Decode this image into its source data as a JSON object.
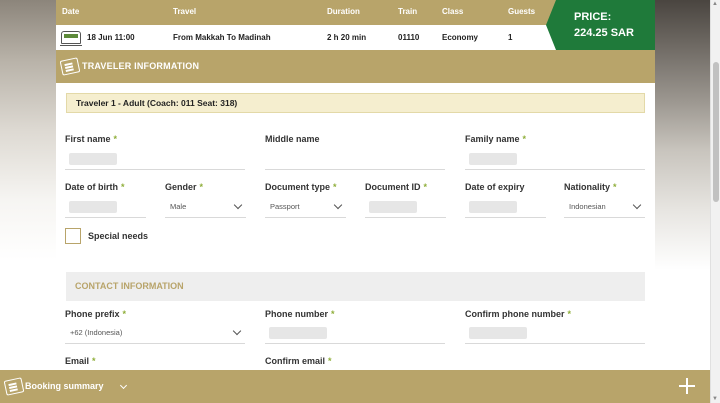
{
  "trip": {
    "headers": {
      "date": "Date",
      "travel": "Travel",
      "duration": "Duration",
      "train": "Train",
      "class": "Class",
      "guests": "Guests"
    },
    "date": "18 Jun 11:00",
    "travel": "From Makkah To Madinah",
    "duration": "2 h 20 min",
    "train": "01110",
    "class": "Economy",
    "guests": "1"
  },
  "price": {
    "label": "PRICE:",
    "value": "224.25 SAR"
  },
  "traveler_section": {
    "title": "TRAVELER INFORMATION"
  },
  "traveler": {
    "banner": "Traveler 1 - Adult (Coach: 011 Seat: 318)"
  },
  "fields": {
    "first_name": {
      "label": "First name"
    },
    "middle_name": {
      "label": "Middle name"
    },
    "family_name": {
      "label": "Family name"
    },
    "date_of_birth": {
      "label": "Date of birth"
    },
    "gender": {
      "label": "Gender",
      "value": "Male"
    },
    "document_type": {
      "label": "Document type",
      "value": "Passport"
    },
    "document_id": {
      "label": "Document ID"
    },
    "date_of_expiry": {
      "label": "Date of expiry"
    },
    "nationality": {
      "label": "Nationality",
      "value": "Indonesian"
    },
    "special_needs": {
      "label": "Special needs"
    }
  },
  "contact_section": {
    "title": "CONTACT INFORMATION"
  },
  "contact": {
    "phone_prefix": {
      "label": "Phone prefix",
      "value": "+62 (Indonesia)"
    },
    "phone_number": {
      "label": "Phone number"
    },
    "confirm_phone": {
      "label": "Confirm phone number"
    },
    "email": {
      "label": "Email"
    },
    "confirm_email": {
      "label": "Confirm email"
    }
  },
  "required_mark": "*",
  "summary": {
    "label": "Booking summary"
  },
  "colors": {
    "accent": "#b8a46a",
    "price_bg": "#1f7a3a",
    "required": "#8fae3a",
    "banner_bg": "#f5eecf"
  },
  "icons": {
    "train": "train-icon",
    "ticket": "ticket-icon",
    "plus": "plus-icon",
    "chevron": "chevron-down-icon"
  }
}
